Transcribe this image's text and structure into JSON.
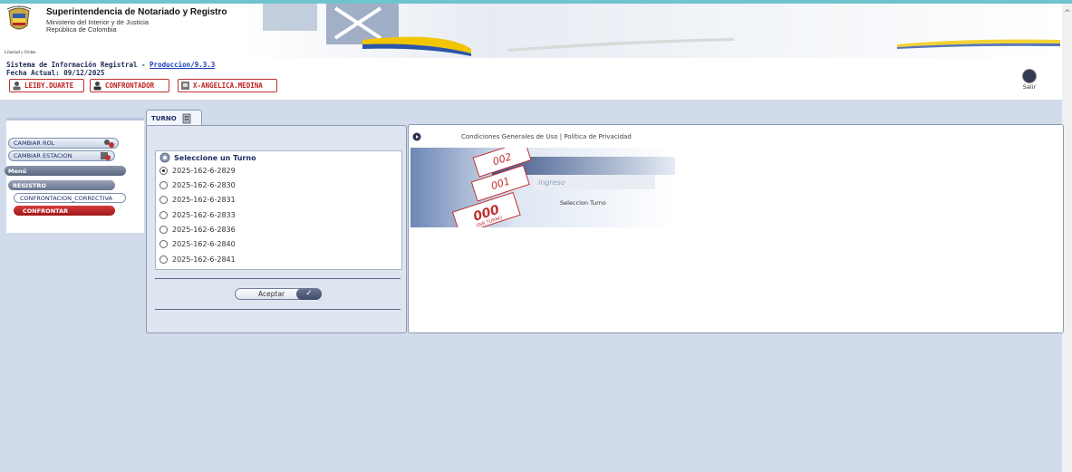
{
  "header": {
    "org_name": "Superintendencia de Notariado y Registro",
    "org_sub1": "Ministerio del Interior y de Justicia",
    "org_sub2": "República de Colombia",
    "logo_caption": "Libertad y Orden",
    "system_label": "Sistema de Información Registral - ",
    "system_link": "Produccion/9.3.3",
    "date_label": "Fecha Actual: 09/12/2025",
    "chips": [
      "LEIBY.DUARTE",
      "CONFRONTADOR",
      "X-ANGELICA.MEDINA"
    ],
    "exit_label": "Salir"
  },
  "sidebar": {
    "change_role": "CAMBIAR ROL",
    "change_station": "CAMBIAR ESTACION",
    "menu_label": "Menú",
    "registro_label": "REGISTRO",
    "items": [
      "CONFRONTACION_CORRECTIVA",
      "CONFRONTAR"
    ]
  },
  "turno": {
    "tab_label": "TURNO",
    "title": "Seleccione un Turno",
    "options": [
      "2025-162-6-2829",
      "2025-162-6-2830",
      "2025-162-6-2831",
      "2025-162-6-2833",
      "2025-162-6-2836",
      "2025-162-6-2840",
      "2025-162-6-2841"
    ],
    "selected_index": 0,
    "accept_label": "Aceptar"
  },
  "content": {
    "links": "Condiciones Generales de Uso | Política de Privacidad",
    "brand": "ingreso",
    "caption": "Seleccion Turno",
    "ticket1": "002",
    "ticket2": "001",
    "ticket3": "000",
    "ticket_sub": "SNR TURNO"
  }
}
